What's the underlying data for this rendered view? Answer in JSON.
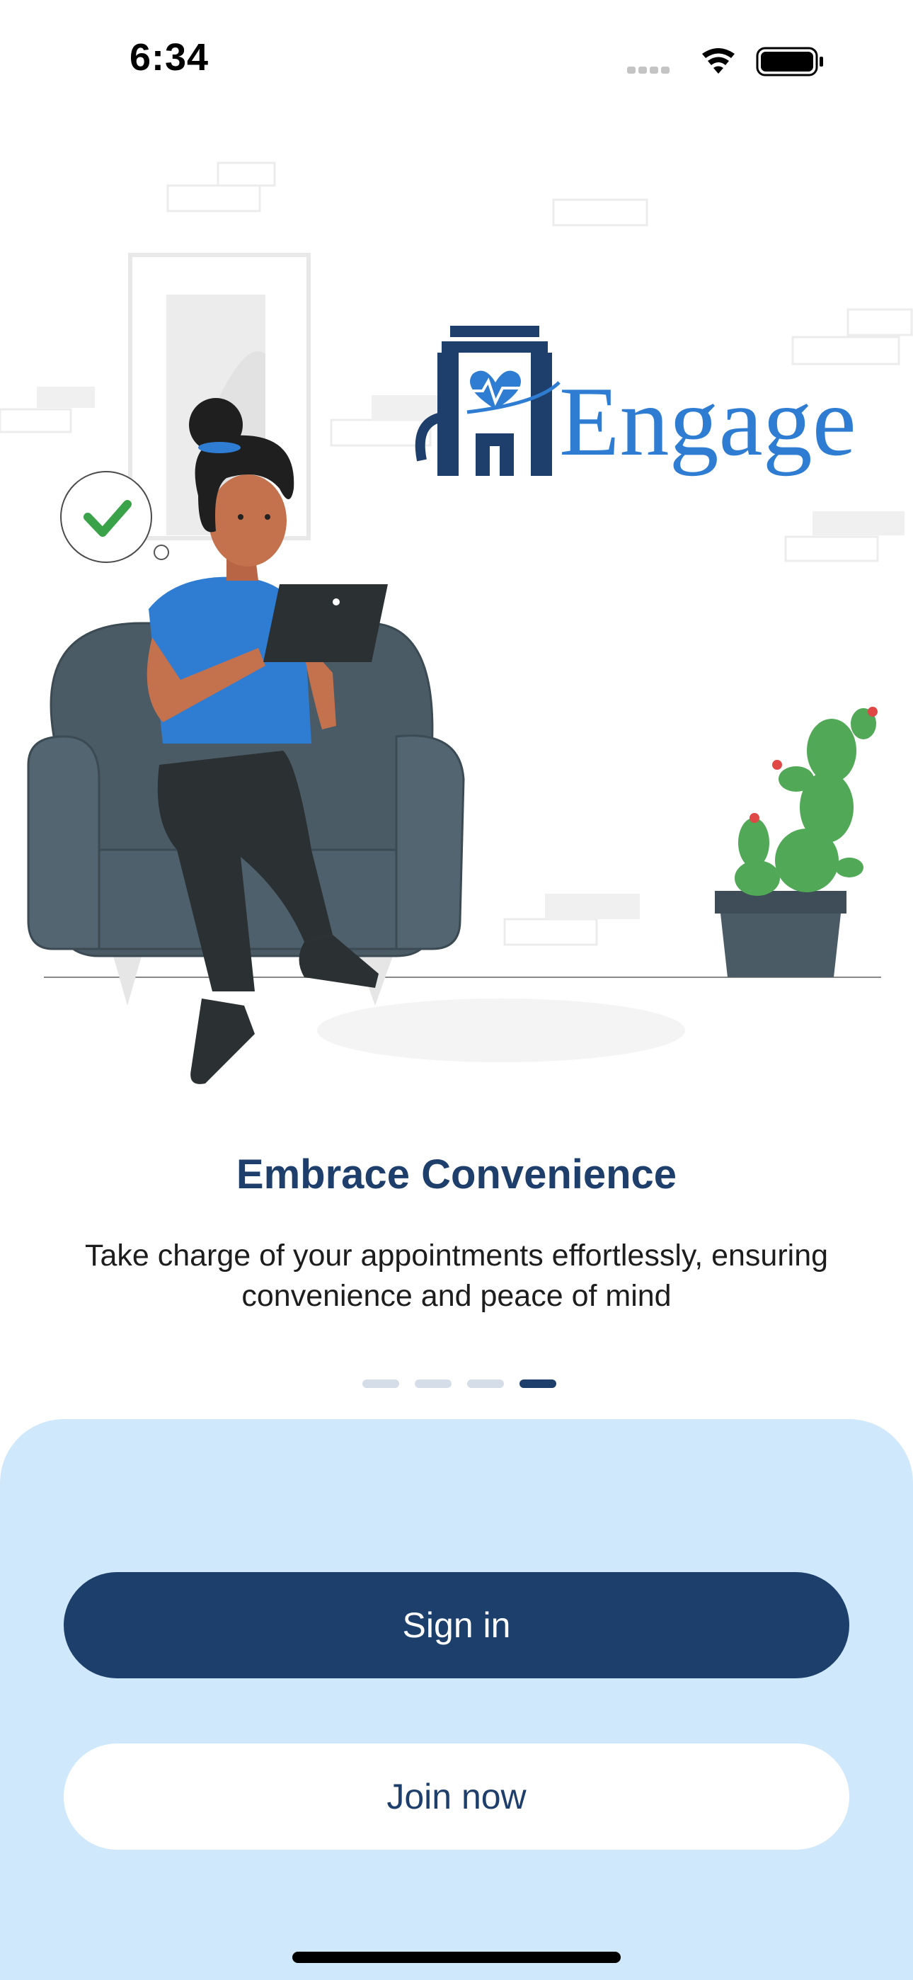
{
  "status_bar": {
    "time": "6:34",
    "icons": [
      "cellular-signal-icon",
      "wifi-icon",
      "battery-icon"
    ]
  },
  "logo": {
    "text": "Engage",
    "icon": "hospital-heart-logo-icon",
    "colors": {
      "dark": "#1e3f6b",
      "light": "#2f7dd2"
    }
  },
  "onboarding": {
    "title": "Embrace Convenience",
    "subtitle": "Take charge of your appointments effortlessly, ensuring convenience and peace of mind",
    "page_count": 4,
    "active_page": 4
  },
  "actions": {
    "sign_in_label": "Sign in",
    "join_now_label": "Join now"
  },
  "colors": {
    "primary": "#1c3f6c",
    "sheet_background": "#d0e8fb",
    "indicator_inactive": "#d4dde8",
    "check_green": "#3aa34a"
  }
}
